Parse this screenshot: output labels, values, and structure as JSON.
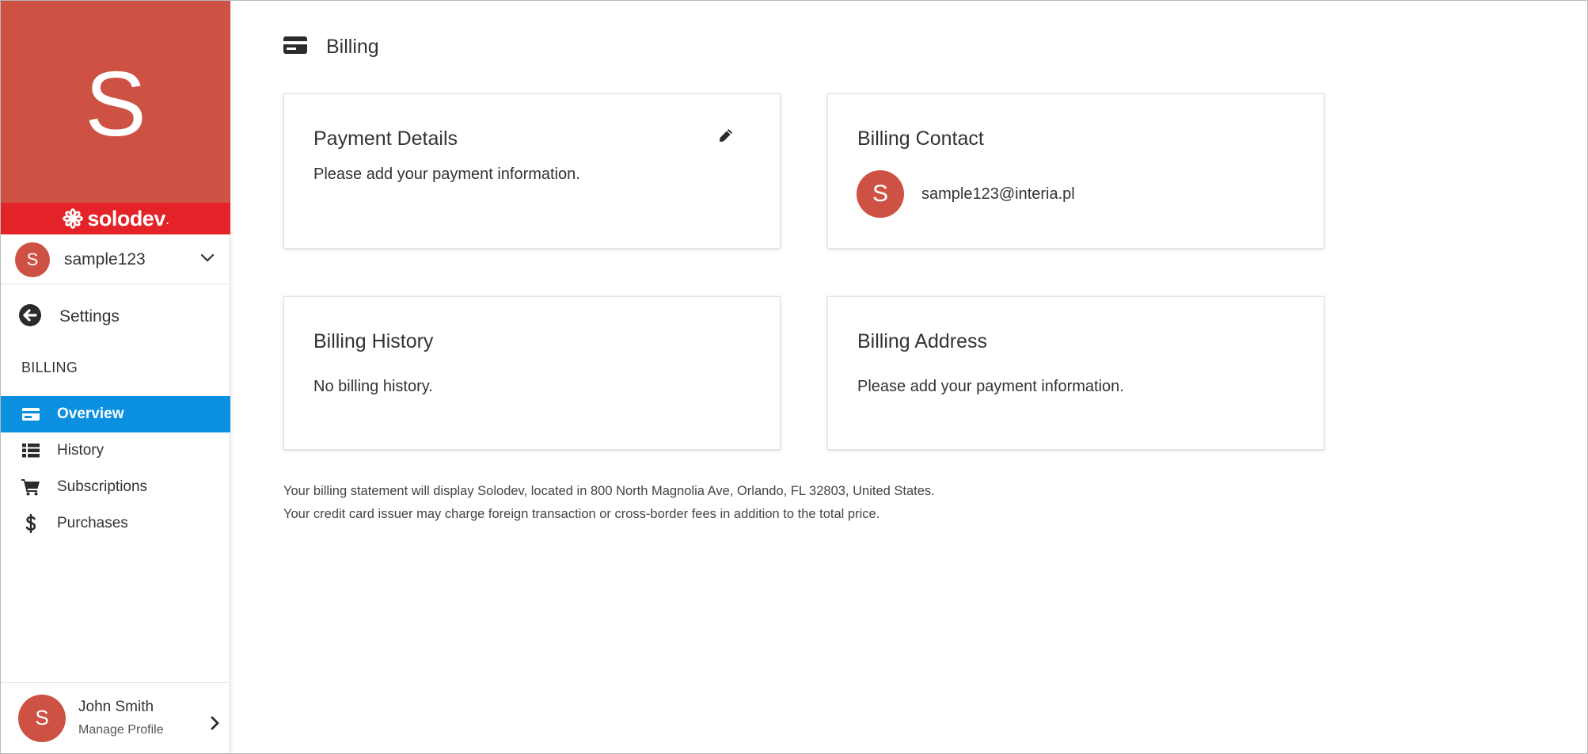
{
  "sidebar": {
    "hero_letter": "S",
    "brand": {
      "name": "solodev",
      "dot": ".",
      "color": "#e32327"
    },
    "hero_color": "#cd5244",
    "account": {
      "avatar": "S",
      "name": "sample123",
      "icon": "chevron-down-icon"
    },
    "settings": {
      "label": "Settings",
      "icon": "arrow-circle-left-icon"
    },
    "section_title": "BILLING",
    "items": [
      {
        "label": "Overview",
        "icon": "credit-card-icon",
        "active": true
      },
      {
        "label": "History",
        "icon": "list-icon",
        "active": false
      },
      {
        "label": "Subscriptions",
        "icon": "shopping-cart-icon",
        "active": false
      },
      {
        "label": "Purchases",
        "icon": "dollar-icon",
        "active": false
      }
    ],
    "profile": {
      "avatar": "S",
      "name": "John Smith",
      "sub": "Manage Profile",
      "icon": "chevron-right-icon"
    },
    "accent_color": "#0b8fe0"
  },
  "main": {
    "title": "Billing",
    "title_icon": "credit-card-icon",
    "cards": {
      "payment": {
        "title": "Payment Details",
        "text": "Please add your payment information.",
        "icon": "pencil-icon"
      },
      "contact": {
        "title": "Billing Contact",
        "avatar": "S",
        "email": "sample123@interia.pl"
      },
      "history": {
        "title": "Billing History",
        "text": "No billing history."
      },
      "address": {
        "title": "Billing Address",
        "text": "Please add your payment information."
      }
    },
    "footnote": {
      "line1": "Your billing statement will display Solodev, located in 800 North Magnolia Ave, Orlando, FL 32803, United States.",
      "line2": "Your credit card issuer may charge foreign transaction or cross-border fees in addition to the total price."
    }
  }
}
